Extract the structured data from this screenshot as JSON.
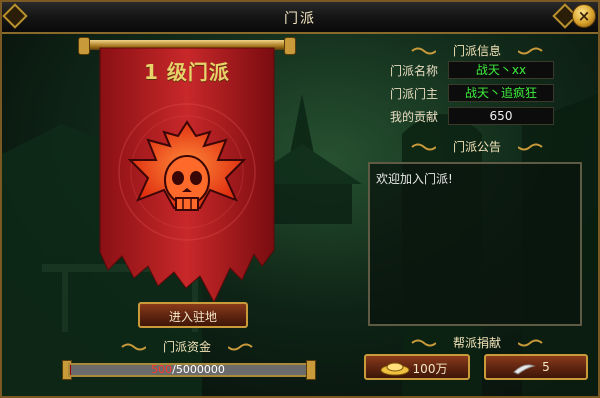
{
  "window": {
    "title": "门派",
    "close_label": "×"
  },
  "banner": {
    "level_title": "1 级门派"
  },
  "info": {
    "section_title": "门派信息",
    "rows": [
      {
        "label": "门派名称",
        "value": "战天丶xx",
        "color": "#3cf03c"
      },
      {
        "label": "门派门主",
        "value": "战天丶追疯狂",
        "color": "#3cf03c"
      },
      {
        "label": "我的贡献",
        "value": "650",
        "color": "#f0f0f0"
      }
    ]
  },
  "notice": {
    "section_title": "门派公告",
    "text": "欢迎加入门派!"
  },
  "enter_button": {
    "label": "进入驻地"
  },
  "funds": {
    "section_title": "门派资金",
    "current": "500",
    "max": "5000000",
    "separator": "/",
    "fill_fraction": 0.0001
  },
  "donate": {
    "section_title": "帮派捐献",
    "buttons": [
      {
        "label": "100万",
        "icon": "gold-ingot-icon"
      },
      {
        "label": "5",
        "icon": "jade-icon"
      }
    ]
  },
  "colors": {
    "accent": "#c89a3a",
    "green_text": "#3cf03c",
    "banner_red": "#c8282a"
  }
}
